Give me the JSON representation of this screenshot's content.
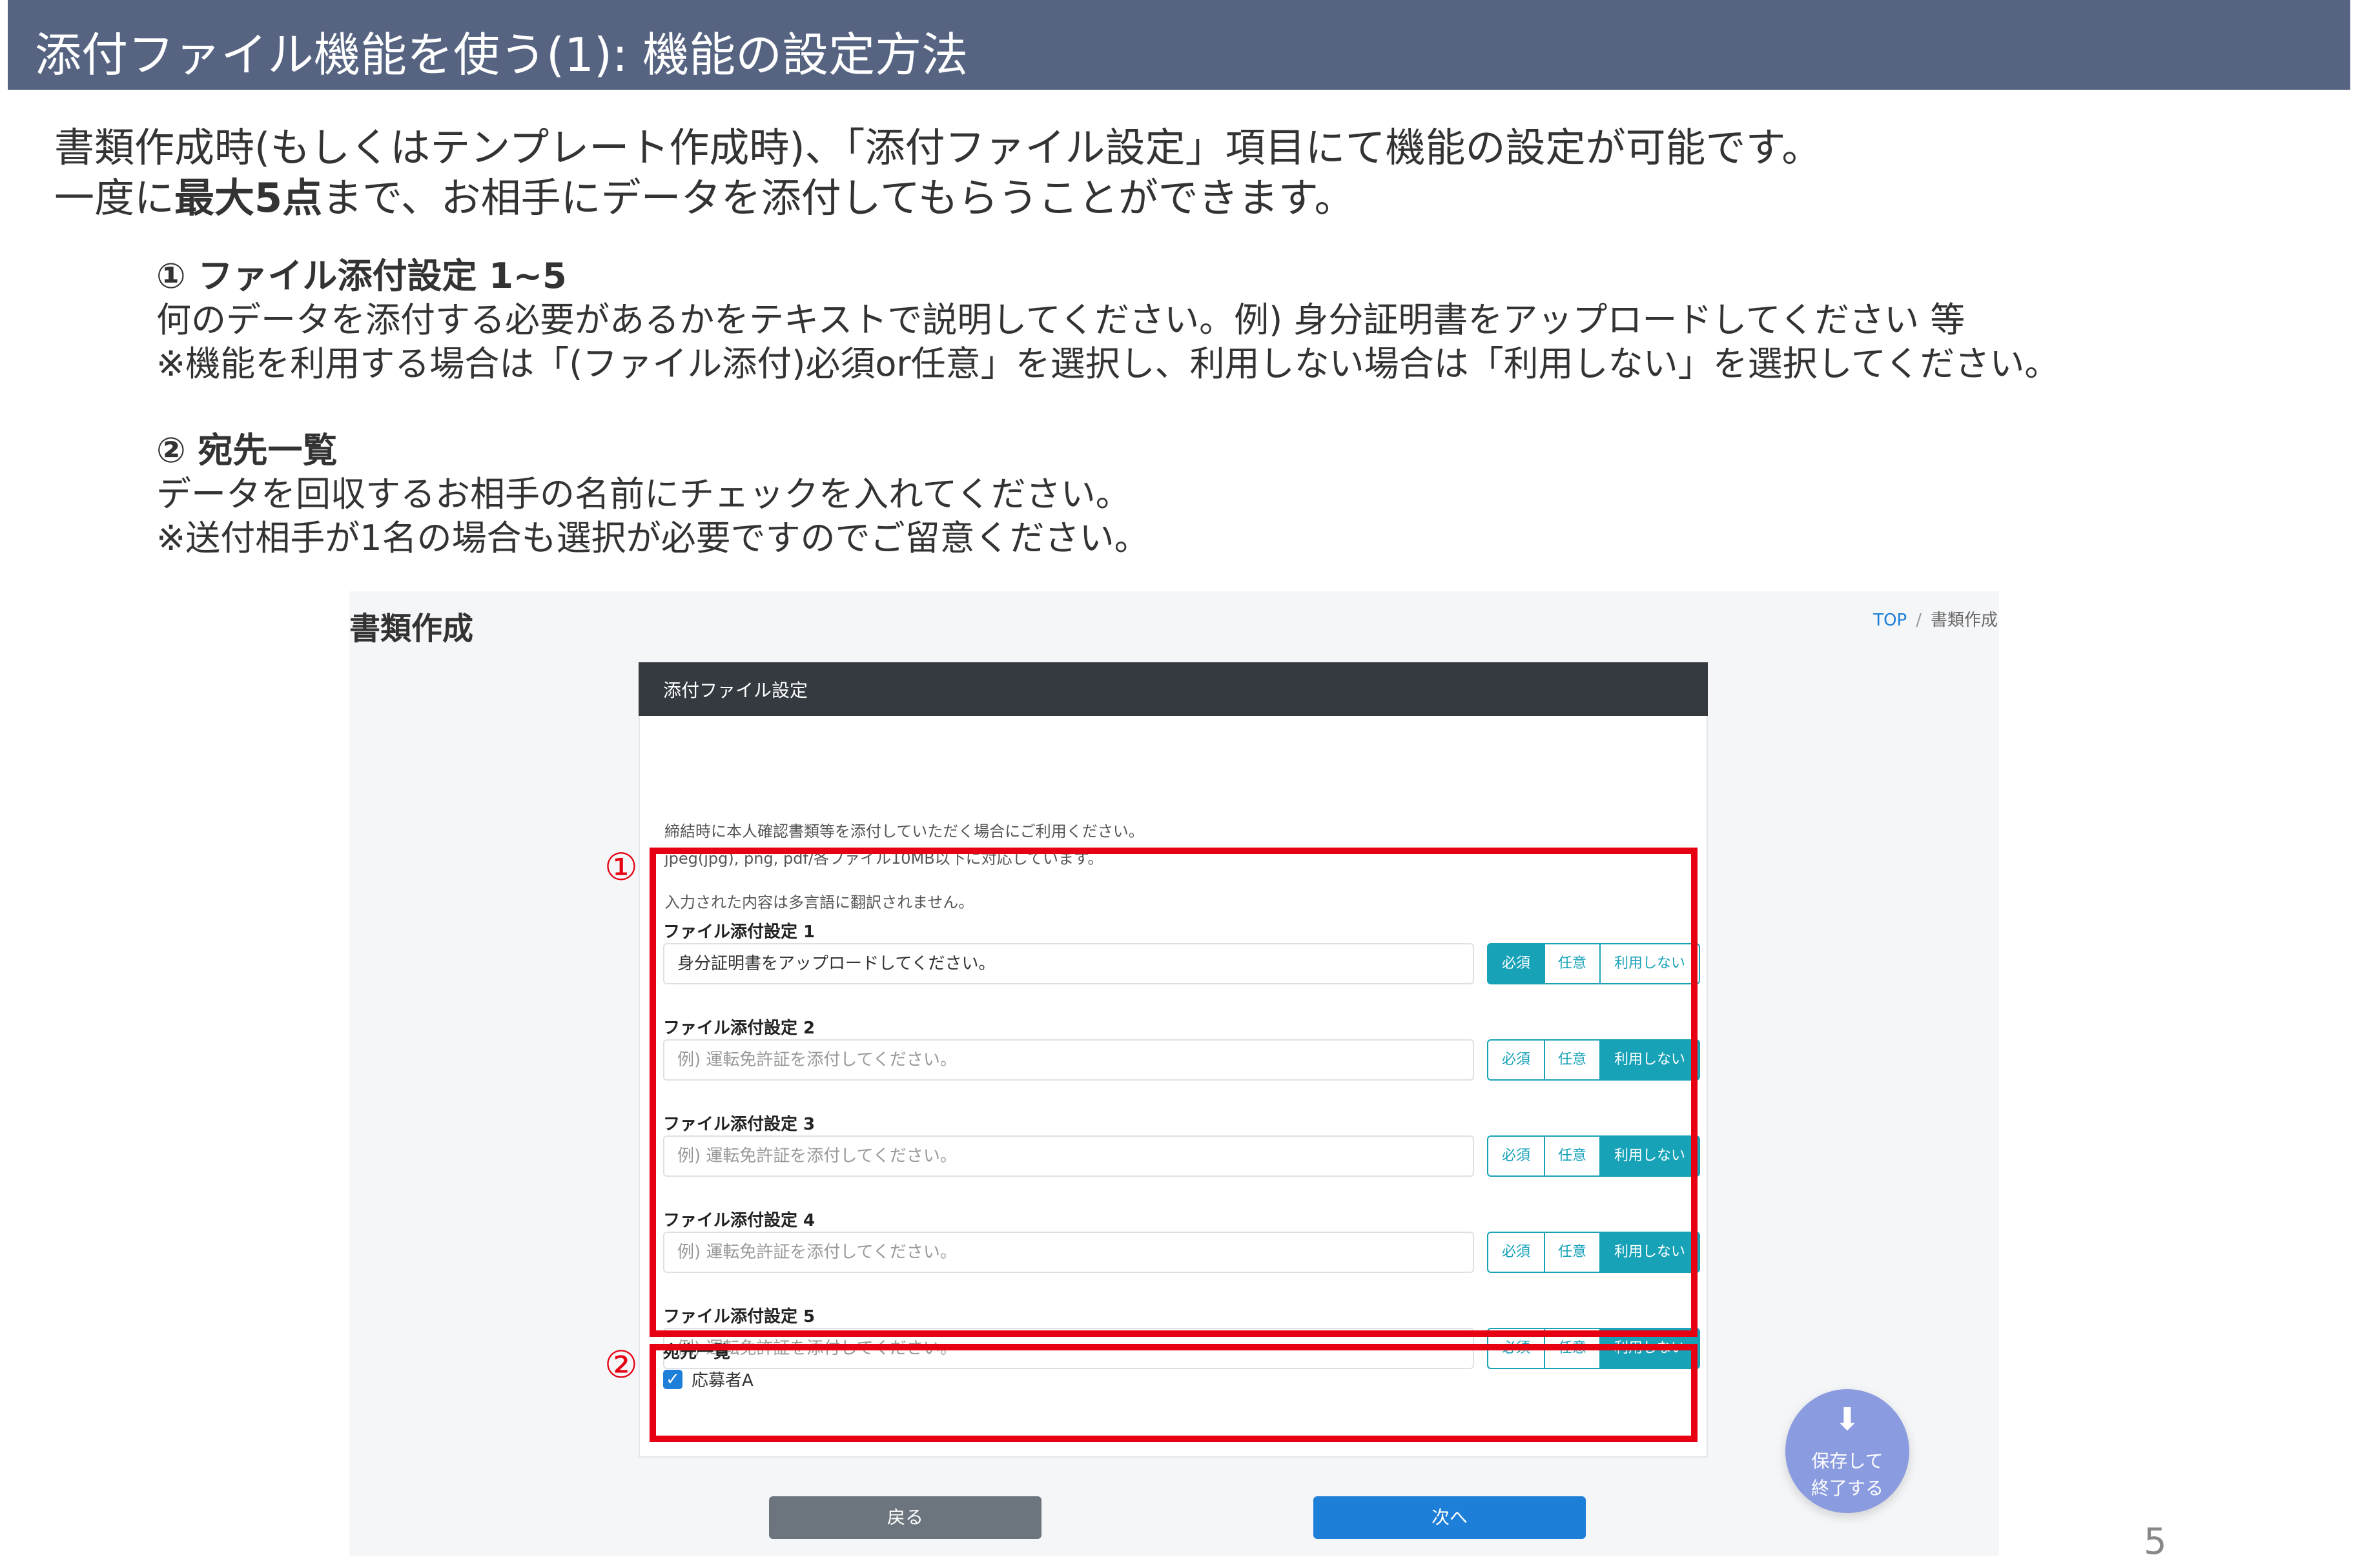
{
  "header": {
    "title": "添付ファイル機能を使う(1): 機能の設定方法"
  },
  "intro": {
    "line1": "書類作成時(もしくはテンプレート作成時)、「添付ファイル設定」項目にて機能の設定が可能です。",
    "line2_prefix": "一度に",
    "line2_bold": "最大5点",
    "line2_suffix": "まで、お相手にデータを添付してもらうことができます。"
  },
  "notes": [
    {
      "heading": "① ファイル添付設定 1~5",
      "line1": "何のデータを添付する必要があるかをテキストで説明してください。例) 身分証明書をアップロードしてください 等",
      "line2": "※機能を利用する場合は「(ファイル添付)必須or任意」を選択し、利用しない場合は「利用しない」を選択してください。"
    },
    {
      "heading": "② 宛先一覧",
      "line1": "データを回収するお相手の名前にチェックを入れてください。",
      "line2": "※送付相手が1名の場合も選択が必要ですのでご留意ください。"
    }
  ],
  "screenshot": {
    "page_title": "書類作成",
    "breadcrumb": {
      "top": "TOP",
      "separator": "/",
      "current": "書類作成"
    },
    "panel": {
      "heading": "添付ファイル設定",
      "desc1": "締結時に本人確認書類等を添付していただく場合にご利用ください。",
      "desc2": "jpeg(jpg), png, pdf/各ファイル10MB以下に対応しています。",
      "desc3": "入力された内容は多言語に翻訳されません。",
      "fields": [
        {
          "label": "ファイル添付設定 1",
          "value": "身分証明書をアップロードしてください。",
          "placeholder": "",
          "selected": "必須"
        },
        {
          "label": "ファイル添付設定 2",
          "value": "",
          "placeholder": "例) 運転免許証を添付してください。",
          "selected": "利用しない"
        },
        {
          "label": "ファイル添付設定 3",
          "value": "",
          "placeholder": "例) 運転免許証を添付してください。",
          "selected": "利用しない"
        },
        {
          "label": "ファイル添付設定 4",
          "value": "",
          "placeholder": "例) 運転免許証を添付してください。",
          "selected": "利用しない"
        },
        {
          "label": "ファイル添付設定 5",
          "value": "",
          "placeholder": "例) 運転免許証を添付してください。",
          "selected": "利用しない"
        }
      ],
      "options": {
        "required": "必須",
        "optional": "任意",
        "unused": "利用しない"
      },
      "recipients_label": "宛先一覧",
      "recipients": [
        {
          "name": "応募者A",
          "checked": true
        }
      ]
    },
    "annotations": {
      "mark1": "①",
      "mark2": "②"
    },
    "buttons": {
      "back": "戻る",
      "next": "次へ"
    },
    "fab": {
      "line1": "保存して",
      "line2": "終了する",
      "icon": "download-icon"
    }
  },
  "page_number": "5",
  "colors": {
    "header_bar": "#566482",
    "accent_teal": "#17a2b8",
    "primary_blue": "#1e7fd8",
    "highlight_red": "#e60012"
  }
}
